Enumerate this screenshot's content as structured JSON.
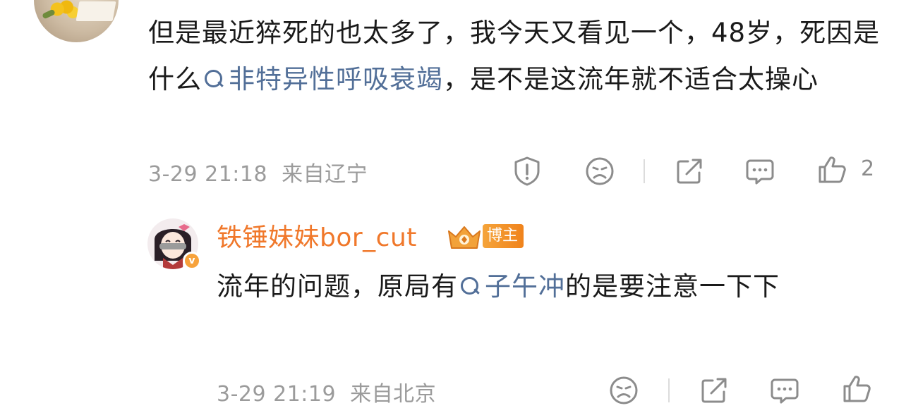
{
  "comment": {
    "text_part1": "但是最近猝死的也太多了，我今天又看见一个，48岁，死因是什么",
    "topic": "非特异性呼吸衰竭",
    "text_part2": "，是不是这流年就不适合太操心",
    "timestamp": "3-29 21:18",
    "location": "来自辽宁",
    "like_count": "2",
    "actions": [
      "report",
      "dislike",
      "share",
      "comment",
      "like"
    ]
  },
  "reply": {
    "username": "铁锤妹妹bor_cut",
    "badge": "博主",
    "text_part1": "流年的问题，原局有",
    "topic": "子午冲",
    "text_part2": "的是要注意一下下",
    "timestamp": "3-29 21:19",
    "location": "来自北京",
    "actions": [
      "dislike",
      "share",
      "comment",
      "like"
    ]
  },
  "colors": {
    "topic_link": "#526f98",
    "username": "#f0782b",
    "meta_text": "#9b9b9b",
    "icon": "#8c8c8c"
  }
}
